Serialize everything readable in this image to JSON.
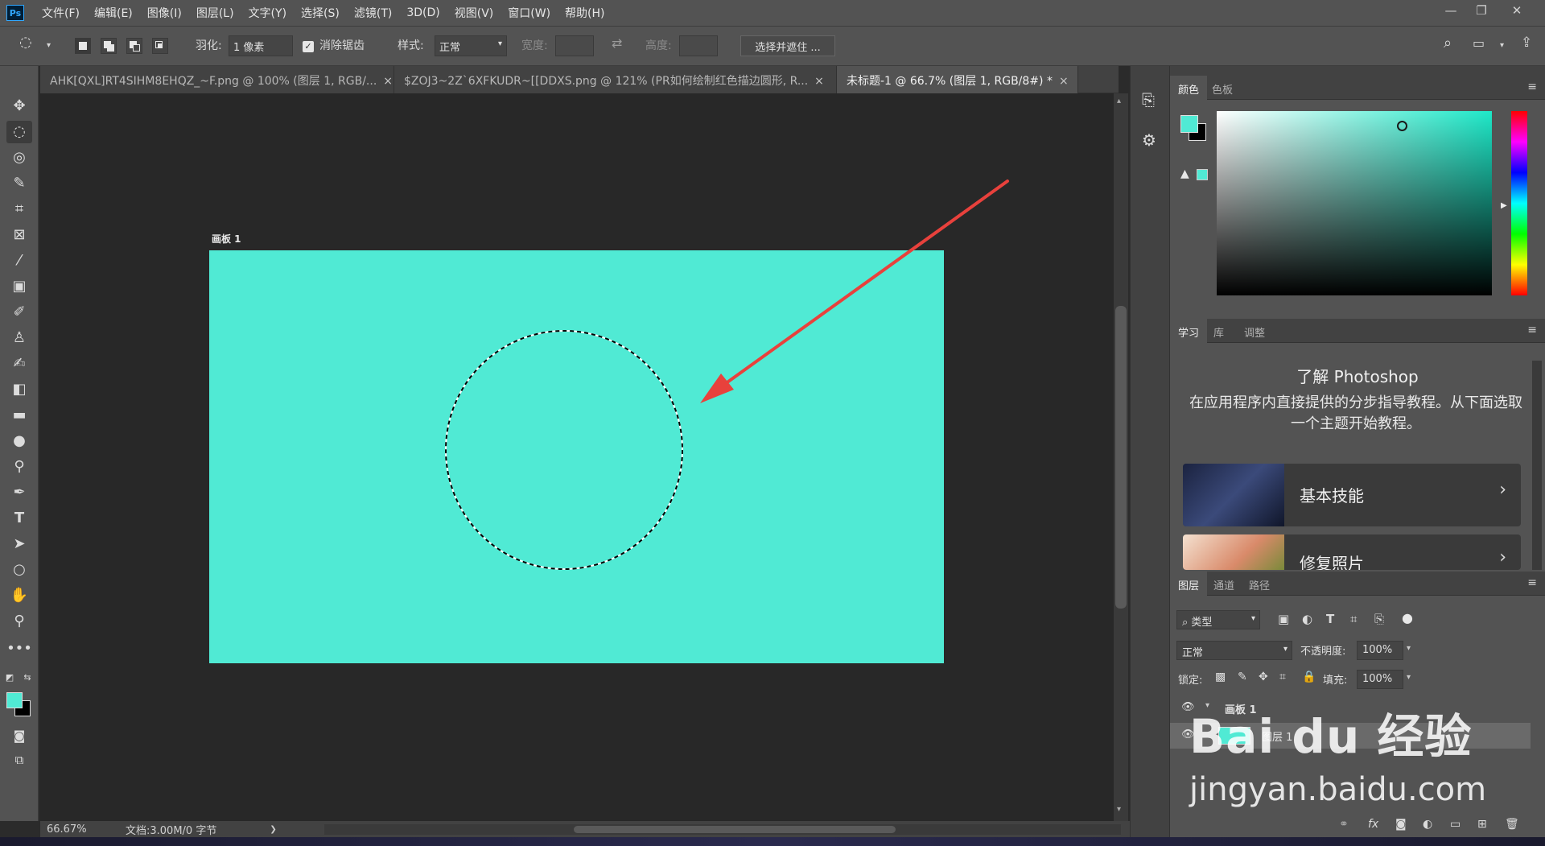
{
  "app": {
    "logo": "Ps"
  },
  "menu": [
    "文件(F)",
    "编辑(E)",
    "图像(I)",
    "图层(L)",
    "文字(Y)",
    "选择(S)",
    "滤镜(T)",
    "3D(D)",
    "视图(V)",
    "窗口(W)",
    "帮助(H)"
  ],
  "window_controls": {
    "minimize": "—",
    "restore": "❐",
    "close": "✕"
  },
  "options": {
    "feather_label": "羽化:",
    "feather_value": "1 像素",
    "antialias_label": "消除锯齿",
    "antialias_checked": true,
    "style_label": "样式:",
    "style_value": "正常",
    "width_label": "宽度:",
    "height_label": "高度:",
    "select_mask_button": "选择并遮住 ..."
  },
  "tabs": [
    {
      "label": "AHK[QXL]RT4SIHM8EHQZ_~F.png @ 100% (图层 1, RGB/...",
      "active": false
    },
    {
      "label": "$ZOJ3~2Z`6XFKUDR~[[DDXS.png @ 121% (PR如何绘制红色描边圆形, R...",
      "active": false
    },
    {
      "label": "未标题-1 @ 66.7% (图层 1, RGB/8#) *",
      "active": true
    }
  ],
  "tab_close": "×",
  "canvas": {
    "artboard_label": "画板 1",
    "artboard_color": "#50ead4",
    "arrow_color": "#e8413c"
  },
  "status": {
    "zoom": "66.67%",
    "doc_info": "文档:3.00M/0 字节",
    "arrow": "❯"
  },
  "color_panel": {
    "tabs": [
      "颜色",
      "色板"
    ],
    "foreground": "#50ead4",
    "background": "#000000"
  },
  "learn_panel": {
    "tabs": [
      "学习",
      "库",
      "调整"
    ],
    "title": "了解 Photoshop",
    "description": "在应用程序内直接提供的分步指导教程。从下面选取一个主题开始教程。",
    "cards": [
      {
        "label": "基本技能"
      },
      {
        "label": "修复照片"
      }
    ],
    "chevron": "›"
  },
  "layers_panel": {
    "tabs": [
      "图层",
      "通道",
      "路径"
    ],
    "filter_label": "类型",
    "blend_mode": "正常",
    "opacity_label": "不透明度:",
    "opacity_value": "100%",
    "lock_label": "锁定:",
    "fill_label": "填充:",
    "fill_value": "100%",
    "layers": [
      {
        "name": "画板 1",
        "type": "artboard"
      },
      {
        "name": "图层 1",
        "type": "layer"
      }
    ]
  },
  "watermark": {
    "brand": "Bai du 经验",
    "url": "jingyan.baidu.com"
  }
}
